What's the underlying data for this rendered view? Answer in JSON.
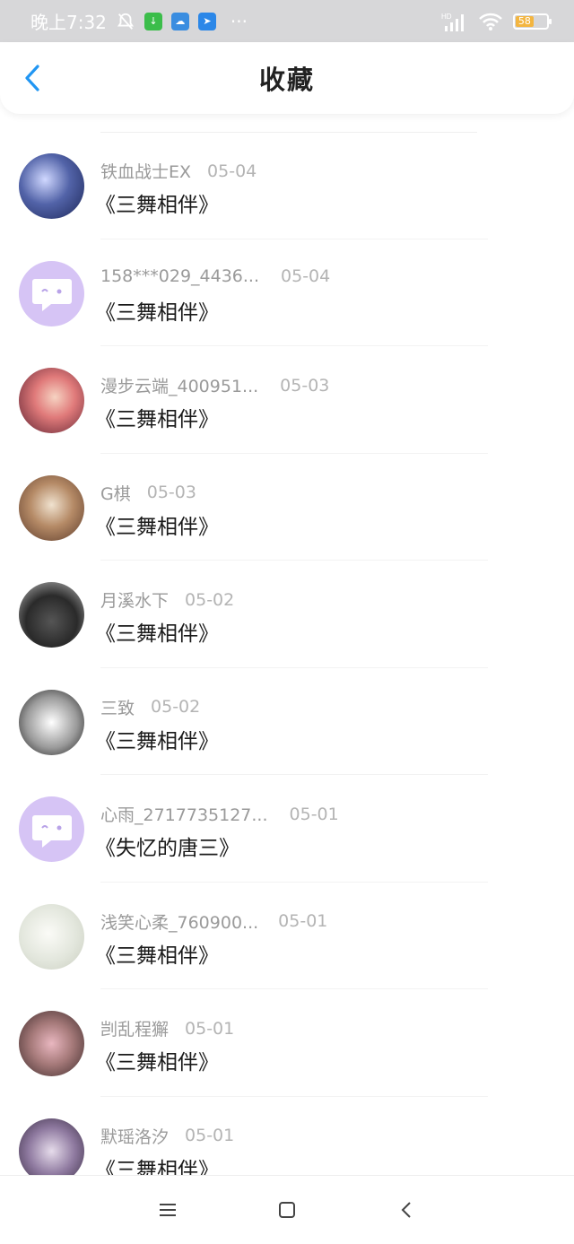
{
  "status_bar": {
    "time": "晚上7:32",
    "battery": "58",
    "notification_icons": [
      "bell-muted-icon",
      "download-icon",
      "weather-icon",
      "app-icon"
    ],
    "more": "···"
  },
  "header": {
    "title": "收藏"
  },
  "favorites": [
    {
      "user": "铁血战士EX",
      "date": "05-04",
      "title": "《三舞相伴》",
      "avatar_color": "#3b4f8f"
    },
    {
      "user": "158***029_4436...",
      "date": "05-04",
      "title": "《三舞相伴》",
      "avatar_color": "#d6c4f5"
    },
    {
      "user": "漫步云端_400951...",
      "date": "05-03",
      "title": "《三舞相伴》",
      "avatar_color": "#b94b4b"
    },
    {
      "user": "G棋",
      "date": "05-03",
      "title": "《三舞相伴》",
      "avatar_color": "#a47c5e"
    },
    {
      "user": "月溪水下",
      "date": "05-02",
      "title": "《三舞相伴》",
      "avatar_color": "#2d2d2d"
    },
    {
      "user": "三致",
      "date": "05-02",
      "title": "《三舞相伴》",
      "avatar_color": "#dddddd"
    },
    {
      "user": "心雨_2717735127...",
      "date": "05-01",
      "title": "《失忆的唐三》",
      "avatar_color": "#d6c4f5"
    },
    {
      "user": "浅笑心柔_760900...",
      "date": "05-01",
      "title": "《三舞相伴》",
      "avatar_color": "#e8ece4"
    },
    {
      "user": "剀乱程獬",
      "date": "05-01",
      "title": "《三舞相伴》",
      "avatar_color": "#8a6a6a"
    },
    {
      "user": "默瑶洛汐",
      "date": "05-01",
      "title": "《三舞相伴》",
      "avatar_color": "#6f5a78"
    }
  ],
  "colors": {
    "accent": "#2196f3",
    "status_bar": "#d7d7d9",
    "default_avatar": "#d6c4f5"
  }
}
